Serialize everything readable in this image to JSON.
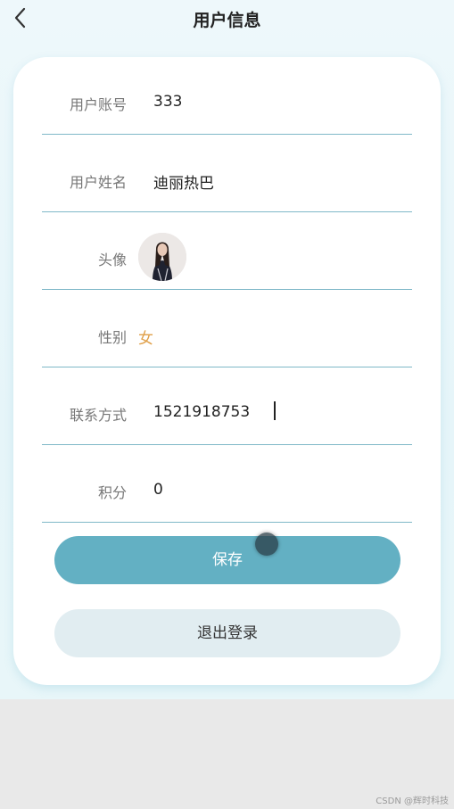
{
  "navbar": {
    "title": "用户信息",
    "back_icon": "chevron-left-icon"
  },
  "fields": {
    "account": {
      "label": "用户账号",
      "value": "333"
    },
    "name": {
      "label": "用户姓名",
      "value": "迪丽热巴"
    },
    "avatar": {
      "label": "头像"
    },
    "gender": {
      "label": "性别",
      "value": "女"
    },
    "contact": {
      "label": "联系方式",
      "value": "1521918753"
    },
    "points": {
      "label": "积分",
      "value": "0"
    }
  },
  "buttons": {
    "save": "保存",
    "logout": "退出登录"
  },
  "colors": {
    "accent": "#63b0c3",
    "gender": "#e0a04a",
    "divider": "#7fb8c8"
  },
  "watermark": "CSDN @辉时科技"
}
